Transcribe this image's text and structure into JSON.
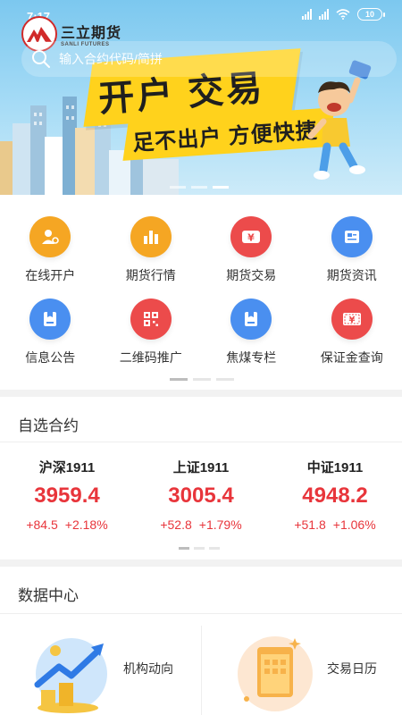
{
  "status_bar": {
    "time": "7:17",
    "battery": "10"
  },
  "brand": {
    "name_cn": "三立期货",
    "name_en": "SANLI FUTURES"
  },
  "search": {
    "placeholder": "输入合约代码/简拼"
  },
  "banner": {
    "headline": "开户 交易",
    "subline": "足不出户 方便快捷",
    "accent_color": "#ffd21c"
  },
  "functions": [
    {
      "label": "在线开户",
      "icon": "open-account-icon",
      "color": "#f5a623"
    },
    {
      "label": "期货行情",
      "icon": "market-chart-icon",
      "color": "#f5a623"
    },
    {
      "label": "期货交易",
      "icon": "trade-yen-icon",
      "color": "#ec4b4b"
    },
    {
      "label": "期货资讯",
      "icon": "news-icon",
      "color": "#4a8ff0"
    },
    {
      "label": "信息公告",
      "icon": "notice-icon",
      "color": "#4a8ff0"
    },
    {
      "label": "二维码推广",
      "icon": "qr-code-icon",
      "color": "#ec4b4b"
    },
    {
      "label": "焦煤专栏",
      "icon": "column-icon",
      "color": "#4a8ff0"
    },
    {
      "label": "保证金查询",
      "icon": "margin-query-icon",
      "color": "#ec4b4b"
    }
  ],
  "watchlist": {
    "title": "自选合约",
    "items": [
      {
        "name": "沪深1911",
        "price": "3959.4",
        "change": "+84.5",
        "change_pct": "+2.18%"
      },
      {
        "name": "上证1911",
        "price": "3005.4",
        "change": "+52.8",
        "change_pct": "+1.79%"
      },
      {
        "name": "中证1911",
        "price": "4948.2",
        "change": "+51.8",
        "change_pct": "+1.06%"
      }
    ],
    "up_color": "#e8353b"
  },
  "data_center": {
    "title": "数据中心",
    "cards": [
      {
        "label": "机构动向",
        "icon": "institution-trend-icon"
      },
      {
        "label": "交易日历",
        "icon": "trade-calendar-icon"
      }
    ]
  }
}
